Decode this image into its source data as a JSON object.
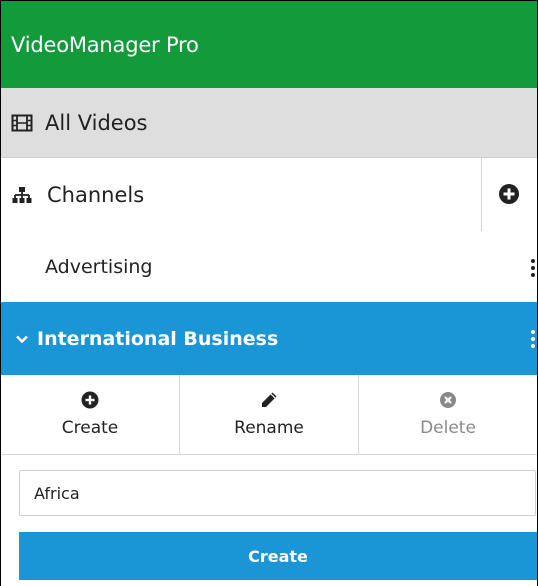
{
  "app": {
    "title": "VideoManager Pro",
    "accent_color": "#139a3a"
  },
  "nav": {
    "all_videos": {
      "label": "All Videos",
      "icon": "film-icon"
    },
    "channels": {
      "label": "Channels",
      "icon": "sitemap-icon",
      "add_icon": "plus-circle-icon"
    }
  },
  "channel_list": {
    "items": [
      {
        "label": "Advertising",
        "selected": false
      },
      {
        "label": "International Business",
        "selected": true,
        "expanded": true
      }
    ],
    "selected_color": "#1a96d6"
  },
  "actions": {
    "create": {
      "label": "Create",
      "icon": "plus-circle-icon"
    },
    "rename": {
      "label": "Rename",
      "icon": "pencil-icon"
    },
    "delete": {
      "label": "Delete",
      "icon": "times-circle-icon",
      "disabled": true
    }
  },
  "form": {
    "name_value": "Africa",
    "submit_label": "Create"
  }
}
